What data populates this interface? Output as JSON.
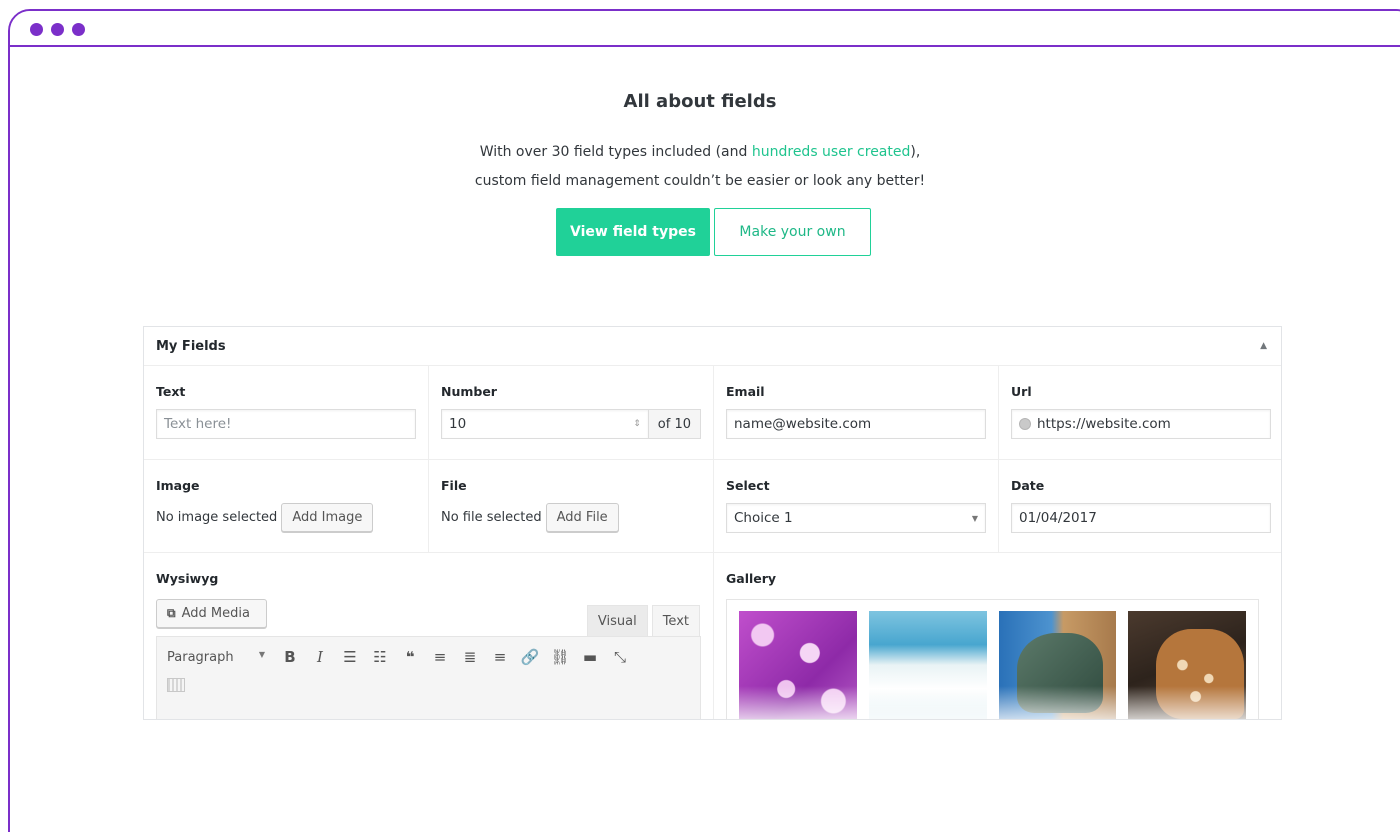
{
  "hero": {
    "title": "All about fields",
    "line1_before": "With over 30 field types included (and ",
    "line1_link": "hundreds user created",
    "line1_after": "),",
    "line2": "custom field management couldn’t be easier or look any better!",
    "primary_button": "View field types",
    "secondary_button": "Make your own"
  },
  "panel": {
    "title": "My Fields",
    "toggle_icon": "triangle-up-icon",
    "text": {
      "label": "Text",
      "placeholder": "Text here!"
    },
    "number": {
      "label": "Number",
      "value": "10",
      "append": "of 10"
    },
    "email": {
      "label": "Email",
      "value": "name@website.com"
    },
    "url": {
      "label": "Url",
      "value": "https://website.com",
      "icon": "globe-icon"
    },
    "image": {
      "label": "Image",
      "status": "No image selected",
      "button": "Add Image"
    },
    "file": {
      "label": "File",
      "status": "No file selected",
      "button": "Add File"
    },
    "select": {
      "label": "Select",
      "value": "Choice 1"
    },
    "date": {
      "label": "Date",
      "value": "01/04/2017"
    },
    "wysiwyg": {
      "label": "Wysiwyg",
      "add_media": "Add Media",
      "tab_visual": "Visual",
      "tab_text": "Text",
      "format": "Paragraph",
      "toolbar_icons": [
        "bold-icon",
        "italic-icon",
        "bullet-list-icon",
        "numbered-list-icon",
        "blockquote-icon",
        "align-left-icon",
        "align-center-icon",
        "align-right-icon",
        "link-icon",
        "unlink-icon",
        "read-more-icon",
        "fullscreen-icon",
        "kitchen-sink-icon"
      ]
    },
    "gallery": {
      "label": "Gallery",
      "images": [
        "flowers-photo",
        "ocean-wave-photo",
        "statue-photo",
        "giraffe-photo"
      ]
    }
  },
  "colors": {
    "accent": "#20d198",
    "frame": "#7b2fc9",
    "link": "#1fc48e"
  }
}
